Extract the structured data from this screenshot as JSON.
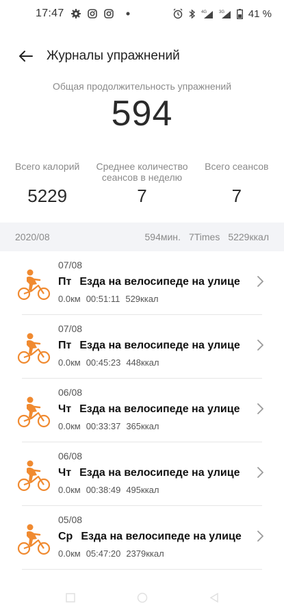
{
  "status_bar": {
    "time": "17:47",
    "icons_left": [
      "gear-icon",
      "instagram-icon",
      "instagram-icon",
      "dot-icon"
    ],
    "icons_right": [
      "alarm-icon",
      "bluetooth-icon",
      "signal-4g-icon",
      "signal-3g-icon",
      "battery-icon"
    ],
    "battery": "41 %"
  },
  "header": {
    "title": "Журналы упражнений"
  },
  "summary": {
    "label": "Общая продолжительность упражнений",
    "value": "594"
  },
  "stats": [
    {
      "label": "Всего калорий",
      "value": "5229"
    },
    {
      "label": "Среднее количество сеансов в неделю",
      "value": "7"
    },
    {
      "label": "Всего сеансов",
      "value": "7"
    }
  ],
  "month": {
    "label": "2020/08",
    "minutes": "594мин.",
    "times": "7Times",
    "kcal": "5229ккал"
  },
  "accent_color": "#f08a30",
  "items": [
    {
      "date": "07/08",
      "day": "Пт",
      "title": "Езда на велосипеде на улице",
      "distance": "0.0км",
      "duration": "00:51:11",
      "kcal": "529ккал"
    },
    {
      "date": "07/08",
      "day": "Пт",
      "title": "Езда на велосипеде на улице",
      "distance": "0.0км",
      "duration": "00:45:23",
      "kcal": "448ккал"
    },
    {
      "date": "06/08",
      "day": "Чт",
      "title": "Езда на велосипеде на улице",
      "distance": "0.0км",
      "duration": "00:33:37",
      "kcal": "365ккал"
    },
    {
      "date": "06/08",
      "day": "Чт",
      "title": "Езда на велосипеде на улице",
      "distance": "0.0км",
      "duration": "00:38:49",
      "kcal": "495ккал"
    },
    {
      "date": "05/08",
      "day": "Ср",
      "title": "Езда на велосипеде на улице",
      "distance": "0.0км",
      "duration": "05:47:20",
      "kcal": "2379ккал"
    }
  ]
}
